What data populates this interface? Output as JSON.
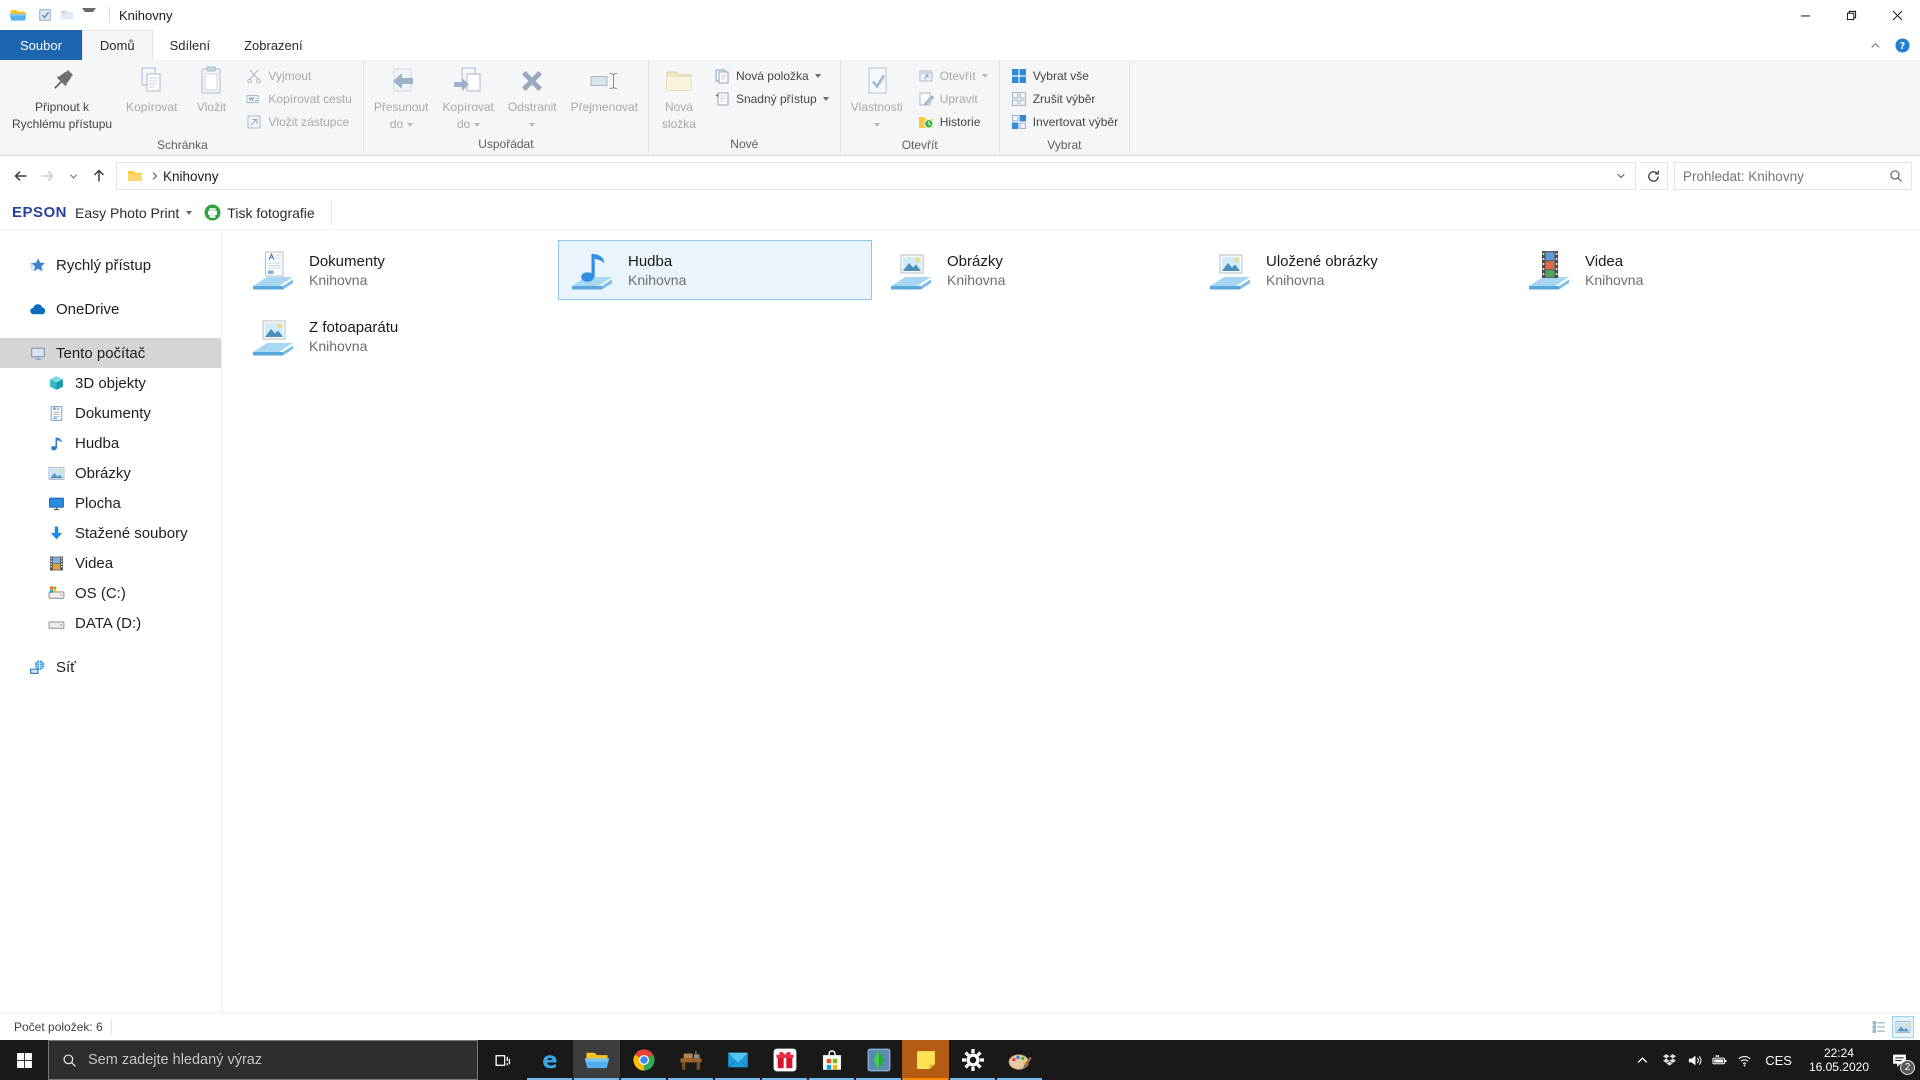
{
  "titlebar": {
    "title": "Knihovny",
    "qat_icons": [
      {
        "icon": "qat-properties",
        "name": "qat-properties-button"
      },
      {
        "icon": "qat-newfolder",
        "name": "qat-new-folder-button"
      }
    ]
  },
  "menu": {
    "file_tab": "Soubor",
    "tabs": [
      {
        "label": "Domů",
        "active": true
      },
      {
        "label": "Sdílení",
        "active": false
      },
      {
        "label": "Zobrazení",
        "active": false
      }
    ]
  },
  "ribbon": {
    "groups": [
      {
        "label": "Schránka",
        "sections": [
          {
            "kind": "large",
            "buttons": [
              {
                "label": "Připnout k",
                "label2": "Rychlému přístupu",
                "icon": "pin",
                "enabled": true
              },
              {
                "label": "Kopírovat",
                "icon": "copy",
                "enabled": false
              },
              {
                "label": "Vložit",
                "icon": "paste",
                "enabled": false
              }
            ]
          },
          {
            "kind": "small",
            "buttons": [
              {
                "label": "Vyjmout",
                "icon": "cut",
                "enabled": false
              },
              {
                "label": "Kopírovat cestu",
                "icon": "copy-path",
                "enabled": false
              },
              {
                "label": "Vložit zástupce",
                "icon": "paste-shortcut",
                "enabled": false
              }
            ]
          }
        ]
      },
      {
        "label": "Uspořádat",
        "sections": [
          {
            "kind": "large",
            "buttons": [
              {
                "label": "Přesunout",
                "label2": "do",
                "icon": "move-to",
                "enabled": false,
                "dropdown": true
              },
              {
                "label": "Kopírovat",
                "label2": "do",
                "icon": "copy-to",
                "enabled": false,
                "dropdown": true
              },
              {
                "label": "Odstranit",
                "icon": "delete",
                "enabled": false,
                "dropdown": true
              },
              {
                "label": "Přejmenovat",
                "icon": "rename",
                "enabled": false
              }
            ]
          }
        ]
      },
      {
        "label": "Nové",
        "sections": [
          {
            "kind": "large",
            "buttons": [
              {
                "label": "Nová",
                "label2": "složka",
                "icon": "new-folder-large",
                "enabled": false
              }
            ]
          },
          {
            "kind": "small",
            "buttons": [
              {
                "label": "Nová položka",
                "icon": "new-item",
                "enabled": true,
                "dropdown": true
              },
              {
                "label": "Snadný přístup",
                "icon": "easy-access",
                "enabled": true,
                "dropdown": true
              }
            ]
          }
        ]
      },
      {
        "label": "Otevřít",
        "sections": [
          {
            "kind": "large",
            "buttons": [
              {
                "label": "Vlastnosti",
                "icon": "properties-large",
                "enabled": false,
                "dropdown": true
              }
            ]
          },
          {
            "kind": "small",
            "buttons": [
              {
                "label": "Otevřít",
                "icon": "open",
                "enabled": false,
                "dropdown": true
              },
              {
                "label": "Upravit",
                "icon": "edit",
                "enabled": false
              },
              {
                "label": "Historie",
                "icon": "history",
                "enabled": true
              }
            ]
          }
        ]
      },
      {
        "label": "Vybrat",
        "sections": [
          {
            "kind": "small",
            "buttons": [
              {
                "label": "Vybrat vše",
                "icon": "select-all",
                "enabled": true
              },
              {
                "label": "Zrušit výběr",
                "icon": "select-none",
                "enabled": true
              },
              {
                "label": "Invertovat výběr",
                "icon": "select-invert",
                "enabled": true
              }
            ]
          }
        ]
      }
    ]
  },
  "navbar": {
    "address": "Knihovny",
    "search_placeholder": "Prohledat: Knihovny"
  },
  "epson": {
    "brand": "EPSON",
    "product": "Easy Photo Print",
    "action": "Tisk fotografie"
  },
  "sidebar": {
    "items": [
      {
        "label": "Rychlý přístup",
        "icon": "star",
        "level": 0,
        "gap": true
      },
      {
        "label": "OneDrive",
        "icon": "cloud",
        "level": 0,
        "gap": true
      },
      {
        "label": "Tento počítač",
        "icon": "pc",
        "level": 0,
        "gap": true,
        "selected": true
      },
      {
        "label": "3D objekty",
        "icon": "cube",
        "level": 1
      },
      {
        "label": "Dokumenty",
        "icon": "doc",
        "level": 1
      },
      {
        "label": "Hudba",
        "icon": "music",
        "level": 1
      },
      {
        "label": "Obrázky",
        "icon": "picture",
        "level": 1
      },
      {
        "label": "Plocha",
        "icon": "desktop",
        "level": 1
      },
      {
        "label": "Stažené soubory",
        "icon": "download",
        "level": 1
      },
      {
        "label": "Videa",
        "icon": "film",
        "level": 1
      },
      {
        "label": "OS (C:)",
        "icon": "drive-c",
        "level": 1
      },
      {
        "label": "DATA (D:)",
        "icon": "drive",
        "level": 1
      },
      {
        "label": "Síť",
        "icon": "network",
        "level": 0,
        "gap": true
      }
    ]
  },
  "content": {
    "tiles": [
      {
        "name": "Dokumenty",
        "type": "Knihovna",
        "icon": "lib-documents",
        "selected": false
      },
      {
        "name": "Hudba",
        "type": "Knihovna",
        "icon": "lib-music",
        "selected": true
      },
      {
        "name": "Obrázky",
        "type": "Knihovna",
        "icon": "lib-pictures",
        "selected": false
      },
      {
        "name": "Uložené obrázky",
        "type": "Knihovna",
        "icon": "lib-pictures",
        "selected": false
      },
      {
        "name": "Videa",
        "type": "Knihovna",
        "icon": "lib-videos",
        "selected": false
      },
      {
        "name": "Z fotoaparátu",
        "type": "Knihovna",
        "icon": "lib-pictures",
        "selected": false
      }
    ]
  },
  "statusbar": {
    "count_label": "Počet položek: 6"
  },
  "taskbar": {
    "search_placeholder": "Sem zadejte hledaný výraz",
    "apps": [
      {
        "name": "edge",
        "icon": "edge",
        "running": true
      },
      {
        "name": "file-explorer",
        "icon": "folder-explorer",
        "running": true,
        "active": true
      },
      {
        "name": "chrome",
        "icon": "chrome",
        "running": true
      },
      {
        "name": "cheat-engine",
        "icon": "cheat-engine",
        "running": true
      },
      {
        "name": "mail",
        "icon": "mail",
        "running": true
      },
      {
        "name": "gift-app",
        "icon": "gift",
        "running": true
      },
      {
        "name": "store",
        "icon": "store",
        "running": true
      },
      {
        "name": "sims",
        "icon": "sims",
        "running": true
      },
      {
        "name": "sticky-notes",
        "icon": "sticky",
        "running": true,
        "attention": true
      },
      {
        "name": "settings",
        "icon": "settings",
        "running": true
      },
      {
        "name": "paint",
        "icon": "paint",
        "running": true
      }
    ],
    "tray": {
      "lang": "CES",
      "time": "22:24",
      "date": "16.05.2020",
      "notification_badge": "2"
    }
  }
}
